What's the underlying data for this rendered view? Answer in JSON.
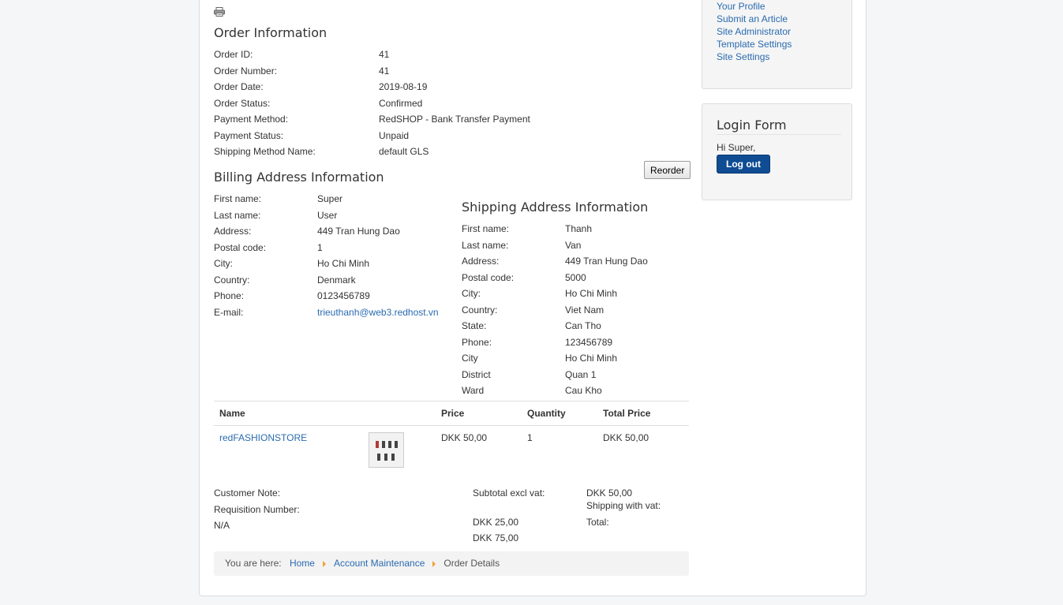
{
  "order_info": {
    "title": "Order Information",
    "rows": [
      {
        "label": "Order ID:",
        "value": "41"
      },
      {
        "label": "Order Number:",
        "value": "41"
      },
      {
        "label": "Order Date:",
        "value": "2019-08-19"
      },
      {
        "label": "Order Status:",
        "value": "Confirmed"
      },
      {
        "label": "Payment Method:",
        "value": "RedSHOP - Bank Transfer Payment"
      },
      {
        "label": "Payment Status:",
        "value": "Unpaid"
      },
      {
        "label": "Shipping Method Name:",
        "value": "default GLS"
      }
    ]
  },
  "reorder_label": "Reorder",
  "billing": {
    "title": "Billing Address Information",
    "rows": [
      {
        "label": "First name:",
        "value": "Super"
      },
      {
        "label": "Last name:",
        "value": "User"
      },
      {
        "label": "Address:",
        "value": "449 Tran Hung Dao"
      },
      {
        "label": "Postal code:",
        "value": "1"
      },
      {
        "label": "City:",
        "value": "Ho Chi Minh"
      },
      {
        "label": "Country:",
        "value": "Denmark"
      },
      {
        "label": "Phone:",
        "value": "0123456789"
      },
      {
        "label": "E-mail:",
        "value": "trieuthanh@web3.redhost.vn"
      }
    ]
  },
  "shipping": {
    "title": "Shipping Address Information",
    "rows": [
      {
        "label": "First name:",
        "value": "Thanh"
      },
      {
        "label": "Last name:",
        "value": "Van"
      },
      {
        "label": "Address:",
        "value": "449 Tran Hung Dao"
      },
      {
        "label": "Postal code:",
        "value": "5000"
      },
      {
        "label": "City:",
        "value": "Ho Chi Minh"
      },
      {
        "label": "Country:",
        "value": "Viet Nam"
      },
      {
        "label": "State:",
        "value": "Can Tho"
      },
      {
        "label": "Phone:",
        "value": "123456789"
      },
      {
        "label": "City",
        "value": "Ho Chi Minh"
      },
      {
        "label": "District",
        "value": "Quan 1"
      },
      {
        "label": "Ward",
        "value": "Cau Kho"
      }
    ]
  },
  "items_table": {
    "headers": [
      "Name",
      "",
      "Price",
      "Quantity",
      "Total Price"
    ],
    "rows": [
      {
        "name": "redFASHIONSTORE",
        "price": "DKK 50,00",
        "quantity": "1",
        "total": "DKK 50,00"
      }
    ]
  },
  "notes": {
    "customer_note_label": "Customer Note:",
    "requisition_label": "Requisition Number:",
    "requisition_value": "N/A"
  },
  "totals": {
    "subtotal_label": "Subtotal excl vat:",
    "subtotal_value": "DKK 50,00",
    "shipping_label": "Shipping with vat:",
    "shipping_value": "DKK 25,00",
    "total_label": "Total:",
    "total_value": "DKK 75,00"
  },
  "breadcrumb": {
    "prefix": "You are here:",
    "items": [
      "Home",
      "Account Maintenance",
      "Order Details"
    ]
  },
  "sidebar": {
    "user_menu": [
      "Your Profile",
      "Submit an Article",
      "Site Administrator",
      "Template Settings",
      "Site Settings"
    ],
    "login": {
      "title": "Login Form",
      "greeting": "Hi Super,",
      "logout_label": "Log out"
    }
  },
  "colors": {
    "link": "#2a6bb0",
    "logout_button": "#0f4c93",
    "breadcrumb_arrow": "#f0a23b"
  },
  "icons": [
    "print-icon"
  ]
}
